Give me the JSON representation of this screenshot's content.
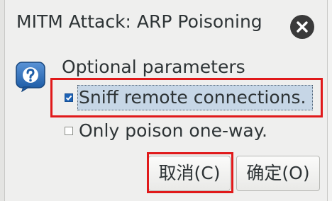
{
  "window": {
    "title": "MITM Attack: ARP Poisoning"
  },
  "dialog": {
    "section_title": "Optional parameters",
    "options": [
      {
        "label": "Sniff remote connections.",
        "checked": true
      },
      {
        "label": "Only poison one-way.",
        "checked": false
      }
    ]
  },
  "buttons": {
    "cancel": "取消(C)",
    "ok": "确定(O)"
  },
  "colors": {
    "highlight": "#e0191a",
    "checkbox_checked": "#1d62b5",
    "focus_bg": "#c6d6e6"
  }
}
